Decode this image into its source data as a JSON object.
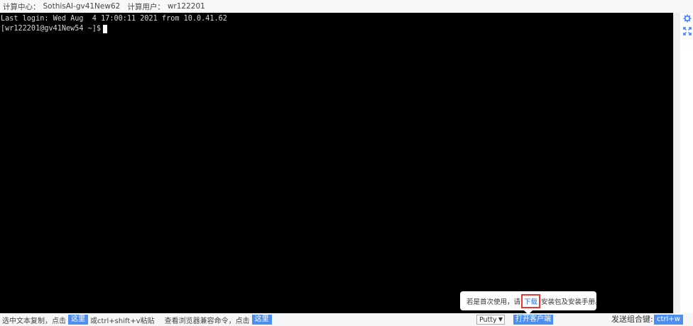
{
  "topbar": {
    "center_label": "计算中心：",
    "center_value": "SothisAI-gv41New62",
    "user_label": "计算用户：",
    "user_value": "wr122201"
  },
  "terminal": {
    "line1": "Last login: Wed Aug  4 17:00:11 2021 from 10.0.41.62",
    "prompt": "[wr122201@gv41New54 ~]$"
  },
  "side_tools": {
    "settings_icon": "gear-icon",
    "fullscreen_icon": "expand-icon"
  },
  "bottombar": {
    "copy_text": "选中文本复制，点击",
    "here1": "这里",
    "paste_text": "或ctrl+shift+v粘贴",
    "browser_text": "查看浏览器兼容命令，点击",
    "here2": "这里",
    "client_select": "Putty",
    "open_client": "打开客户端",
    "combo_label": "发送组合键:",
    "combo_button": "ctrl+w"
  },
  "tooltip": {
    "prefix": "若是首次使用，请",
    "download": "下载",
    "suffix": "安装包及安装手册。"
  },
  "colors": {
    "accent": "#4d8ff0",
    "terminal_bg": "#000000",
    "highlight": "#e53935"
  }
}
